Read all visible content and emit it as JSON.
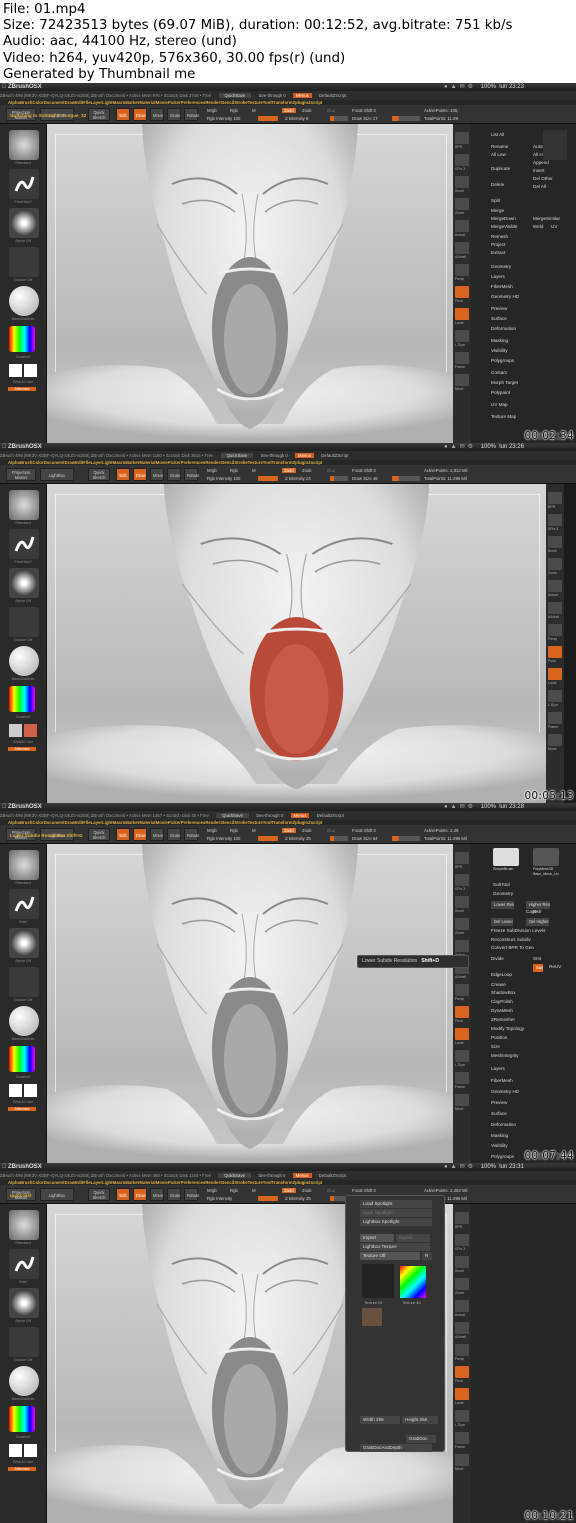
{
  "header": {
    "file": "File: 01.mp4",
    "size": "Size: 72423513 bytes (69.07 MiB), duration: 00:12:52, avg.bitrate: 751 kb/s",
    "audio": "Audio: aac, 44100 Hz, stereo (und)",
    "video": "Video: h264, yuv420p, 576x360, 30.00 fps(r) (und)",
    "generated": "Generated by Thumbnail me"
  },
  "common": {
    "app_name": "ZBrushOSX",
    "battery": "100%",
    "menu_items": [
      "Alpha",
      "Brush",
      "Color",
      "Document",
      "Draw",
      "Edit",
      "File",
      "Layer",
      "Light",
      "Macro",
      "Marker",
      "Material",
      "Movie",
      "Picker",
      "Preferences",
      "Render",
      "Stencil",
      "Stroke",
      "Texture",
      "Tool",
      "Transform",
      "Zplugin",
      "Zscript"
    ],
    "quicksave": "QuickSave",
    "seethrough": "See-through 0",
    "menus_btn": "Menus",
    "script": "DefaultZScript",
    "projection_master": "Projection Master",
    "lightbox": "LightBox",
    "quick_sketch": "Quick Sketch",
    "edit": "Edit",
    "draw": "Draw",
    "move": "Move",
    "scale": "Scale",
    "rotate": "Rotate",
    "mrgb": "Mrgb",
    "rgb": "Rgb",
    "m": "M",
    "zadd": "Zadd",
    "zsub": "Zsub",
    "zcut": "Zcut",
    "focal_shift": "Focal Shift 0",
    "gradient": "Gradient",
    "switch_color": "SwitchColor",
    "alternate": "Alternate",
    "standard": "Standard",
    "freehand": "FreeHand",
    "dots": "Dots",
    "alpha_off": "Alpha Off",
    "texture_off": "Texture Off",
    "basic_material": "BasicMaterial",
    "shelf_labels": [
      "BPR",
      "SPix 3",
      "Scroll",
      "Zoom",
      "Actual",
      "AAHalf",
      "Persp",
      "Floor",
      "Local",
      "L.Sym",
      "Frame",
      "Move",
      "Scale",
      "Rotate",
      "PolyF",
      "Transp",
      "Solo",
      "Xpose"
    ]
  },
  "frames": [
    {
      "time": "lun 23:23",
      "timestamp": "00:02:34",
      "doc_info": "ZBrush 4R6 [MK3V-XDEF-QYLQ-DEZS-NZ5S]   ZBrush Document   • Active Mem 976 • Scratch Disk 3748 • Free",
      "subtool_msg": "Switching to Subtool 2:  Tongue_32",
      "rgb_intensity": "Rgb Intensity 100",
      "z_intensity": "Z Intensity 9",
      "draw_size": "Draw Size 17",
      "active_points": "ActivePoints: 436,",
      "total_points": "TotalPoints: 11.49",
      "tongue": "gray",
      "right_items": [
        "List All",
        "Rename",
        "All Low",
        "AutoReorder",
        "All High",
        "Duplicate",
        "Append",
        "Insert",
        "Delete",
        "Del Other",
        "Del All",
        "Split",
        "Merge",
        "MergeDown",
        "MergeSimilar",
        "MergeVisible",
        "Weld",
        "UV",
        "Remesh",
        "Project",
        "Extract",
        "Geometry",
        "Layers",
        "FiberMesh",
        "Geometry HD",
        "Preview",
        "Surface",
        "Deformation",
        "Masking",
        "Visibility",
        "Polygroups",
        "Contact",
        "Morph Target",
        "Polypaint",
        "UV Map",
        "Texture Map"
      ]
    },
    {
      "time": "lun 23:26",
      "timestamp": "00:05:13",
      "doc_info": "ZBrush 4R6 [MK3V-XDEF-QYLQ-DEZS-NZ5S]   ZBrush Document   • Active Mem 1180 • Scratch Disk 3615 • Free",
      "rgb_intensity": "Rgb Intensity 100",
      "z_intensity": "Z Intensity 24",
      "draw_size": "Draw Size 46",
      "active_points": "ActivePoints: 4,814 Mil",
      "total_points": "TotalPoints: 11.496 Mil",
      "tongue": "red"
    },
    {
      "time": "lun 23:28",
      "timestamp": "00:07:44",
      "doc_info": "ZBrush 4R6 [MK3V-XDEF-QYLQ-DEZS-NZ5S]   ZBrush Document   • Active Mem 1357 • Scratch Disk 40 • Free",
      "subtool_msg": "Lower Subdiv Resolution  Shift+D",
      "rgb_intensity": "Rgb Intensity 100",
      "z_intensity": "Z Intensity 25",
      "draw_size": "Draw Size 64",
      "active_points": "ActivePoints: 2.29",
      "total_points": "TotalPoints: 11.496 Mil",
      "tooltip_text": "Lower Subdiv Resolution",
      "tooltip_key": "Shift+D",
      "right_top": [
        "SimpleBrush",
        "PolyMesh3D",
        "Base_Mesh_Un"
      ],
      "right_items": [
        "SubTool",
        "Geometry",
        "Lower Res",
        "Higher Res",
        "Cage",
        "Rstr",
        "Del Lower",
        "Del Higher",
        "Freeze SubDivision Levels",
        "Reconstruct Subdiv",
        "Convert BPR To Geo",
        "Divide",
        "Smt",
        "Suv",
        "ReUV",
        "EdgeLoop",
        "Crease",
        "ShadowBox",
        "ClayPolish",
        "DynaMesh",
        "ZRemesher",
        "Modify Topology",
        "Position",
        "Size",
        "MeshIntegrity",
        "Layers",
        "FiberMesh",
        "Geometry HD",
        "Preview",
        "Surface",
        "Deformation",
        "Masking",
        "Visibility",
        "Polygroups",
        "Contact"
      ]
    },
    {
      "time": "lun 23:31",
      "timestamp": "00:10:21",
      "doc_info": "ZBrush 4R6 [MK3V-XDEF-QYLQ-DEZS-NZ5S]   ZBrush Document   • Active Mem 485 • Scratch Disk 1184 • Free",
      "subtool_msg": "quick test",
      "rgb_intensity": "Rgb Intensity",
      "z_intensity": "Z Intensity 25",
      "active_points": "ActivePoints: 2.263 Mil",
      "total_points": "TotalPoints: 11.496 Mil",
      "popup": {
        "load_spotlight": "Load Spotlight",
        "save_spotlight": "Save Spotlight",
        "lightbox_spotlight": "Lightbox Spotlight",
        "import": "Import",
        "export": "Export",
        "lightbox_texture": "Lightbox Texture",
        "texture_off": "Texture Off",
        "r": "R",
        "texture_01": "Texture 01",
        "texture_40": "Texture 40",
        "width": "Width 256",
        "height": "Height 256",
        "grabdoc": "GrabDoc",
        "grabdocdepth": "GrabDocAndDepth",
        "image_plane": "Image Plane"
      }
    }
  ]
}
